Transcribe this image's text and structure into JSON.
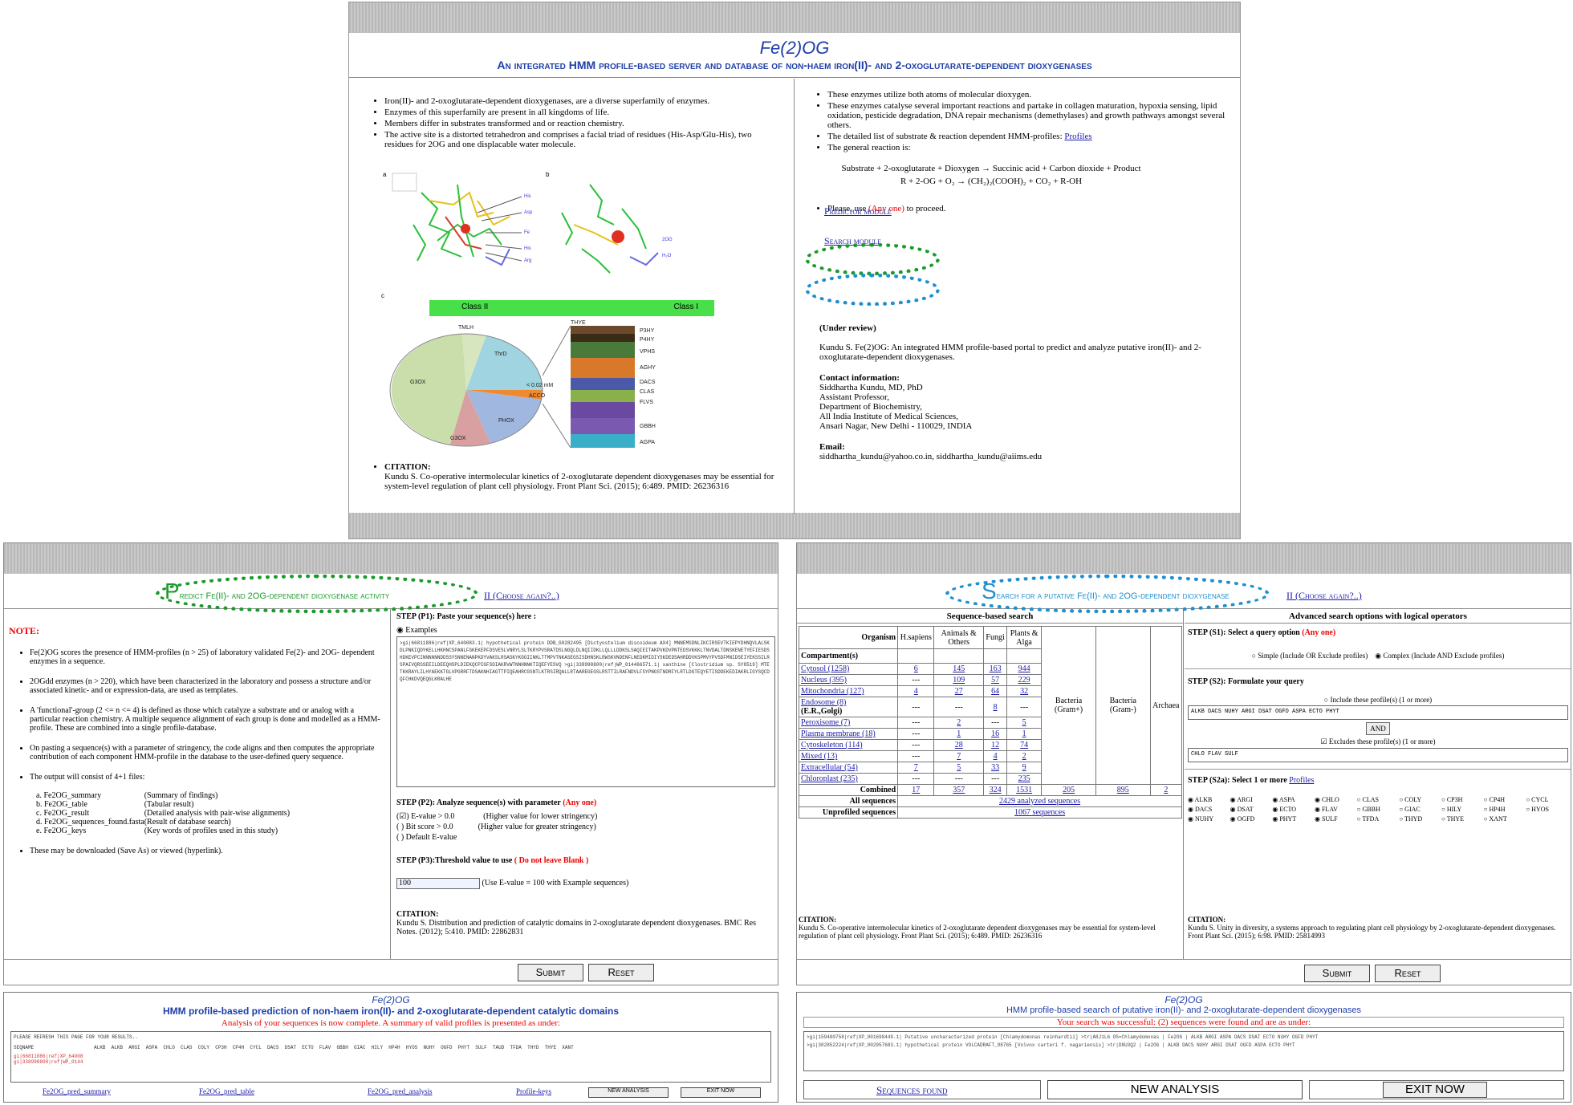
{
  "top": {
    "title": "Fe(2)OG",
    "subtitle": "An integrated HMM profile-based server and database of non-haem iron(II)- and 2-oxoglutarate-dependent dioxygenases",
    "left_bullets": [
      "Iron(II)- and 2-oxoglutarate-dependent dioxygenases, are a diverse superfamily of enzymes.",
      "Enzymes of this superfamily are present in all kingdoms of life.",
      "Members differ in substrates transformed and or reaction chemistry.",
      "The active site is a distorted tetrahedron and comprises a facial triad of residues (His-Asp/Glu-His), two residues for 2OG and one displacable water molecule."
    ],
    "fig_labels": {
      "a": "a",
      "b": "b",
      "c": "c"
    },
    "class_bar": {
      "left": "Class II",
      "right": "Class I"
    },
    "pie_labels": [
      "TMLH",
      "ThrD",
      "G3OX",
      "G3OX",
      "PHOX",
      "< 0.02 mM",
      "ACCO"
    ],
    "stack_labels": [
      "THYE",
      "P3HY",
      "P4HY",
      "VPHS",
      "AGHY",
      "DACS",
      "CLAS",
      "FLVS",
      "GBBH",
      "AGPA"
    ],
    "citation_label": "CITATION:",
    "citation_text": "Kundu S. Co-operative intermolecular kinetics of 2-oxoglutarate dependent dioxygenases may be essential for system-level regulation of plant cell physiology. Front Plant Sci. (2015); 6:489. PMID: 26236316",
    "right_bullets": [
      "These enzymes utilize both atoms of molecular dioxygen.",
      "These enzymes catalyse several important reactions and partake in collagen maturation, hypoxia sensing, lipid oxidation, pesticide degradation, DNA repair mechanisms (demethylases) and growth pathways amongst several others.",
      "The detailed list of substrate & reaction dependent HMM-profiles: ",
      "The general reaction is:"
    ],
    "profiles_link": "Profiles",
    "reaction1": "Substrate + 2-oxoglutarate + Dioxygen → Succinic acid + Carbon dioxide + Product",
    "reaction2": "R + 2-OG + O₂ → (CH₂)₂(COOH)₂ + CO₂ + R-OH",
    "please": "Please, use",
    "anyone": "(Any one)",
    "toproceed": "to proceed.",
    "predictor": "Predictor module",
    "search": "Search module",
    "under_review": "(Under review)",
    "review_text": "Kundu S. Fe(2)OG: An integrated HMM profile-based portal to predict and analyze putative iron(II)- and 2-oxoglutarate-dependent dioxygenases.",
    "contact_label": "Contact information:",
    "contact_lines": [
      "Siddhartha Kundu, MD, PhD",
      "Assistant Professor,",
      "Department of Biochemistry,",
      "All India Institute of Medical Sciences,",
      "Ansari Nagar, New Delhi - 110029, INDIA"
    ],
    "email_label": "Email:",
    "email_text": "siddhartha_kundu@yahoo.co.in,  siddhartha_kundu@aiims.edu"
  },
  "predict": {
    "header_big": "P",
    "header_rest": "redict Fe(II)- and 2OG-dependent dioxygenase activity",
    "choose": "II (Choose again?..)",
    "note": "NOTE:",
    "bullets": [
      "Fe(2)OG scores the presence of HMM-profiles (n > 25) of laboratory validated Fe(2)- and 2OG- dependent enzymes in a sequence.",
      "2OGdd enzymes (n > 220), which have been characterized in the laboratory and possess a structure and/or associated kinetic- and or expression-data, are used as templates.",
      "A 'functional'-group (2 <= n <= 4) is defined as those which catalyze a substrate and or analog with a particular reaction chemistry. A multiple sequence alignment of each group is done and modelled as a HMM-profile. These are combined into a single profile-database.",
      "On pasting a sequence(s) with a parameter of stringency, the code aligns and then computes the appropriate contribution of each component HMM-profile in the database to the user-defined query sequence.",
      "The output will consist of 4+1 files:"
    ],
    "files": [
      [
        "a. Fe2OG_summary",
        "(Summary of findings)"
      ],
      [
        "b. Fe2OG_table",
        "(Tabular result)"
      ],
      [
        "c. Fe2OG_result",
        "(Detailed analysis with pair-wise alignments)"
      ],
      [
        "d. Fe2OG_sequences_found.fasta",
        "(Result of database search)"
      ],
      [
        "e. Fe2OG_keys",
        "(Key words of profiles used in this study)"
      ]
    ],
    "download": "These may be downloaded (Save As) or viewed (hyperlink).",
    "p1": "STEP (P1): Paste your sequence(s) here :",
    "examples": "Examples",
    "seq_text": ">gi|66811886|ref|XP_640083.1| hypothetical protein DDB_G0282495 [Dictyostelium discoideum AX4] MNNEMSDNLIKCIRSEVTKIEPYDHNQVLALSKDLPNKIQDYKELLHKHNCSPANLFGKEKEPFDSVESLVNRYLSLTKRYPVSRATDSLNGQLDLNQIIDKLLQLLLDDKSLSAQIEITAKPVKDVPNTEDSVKKKLTNVDALTDNSKENETYEFIESDSHDKEVPCINNNNNNDDSSYSNNENANPKDYVAKSLRSASKYKGGIINKLTTMPVTNKASEGSISDHNSKLRWSKVNDENFLNEDKMIDIYSKDEDSAHRDDVKSPMVYPVSDFMNIDSEIYEKSSILRSPAIVQRSSEEILDEEQHSPLDIEKQCPIGFSDIAKRVWTNNHNNKTIQEFYESVQ >gi|338998800|ref|WP_014466571.1| xanthine [Clostridium sp. SY8519] MTETKKRAYLILHYAEKKTGLVPGRRFTDSAKNHIAGTTPIQEAHRCGSNTLKTRSIRQALLRTAAREGEGSLRSTTILRAFNDVLFSYPNGSTNDRFYLRTLDGTEQYETISDDEKEDIAKRLIGYSQCDQFCHKDVQEQGLKRALHE",
    "p2": "STEP (P2): Analyze sequence(s) with parameter",
    "p2_anyone": "(Any one)",
    "opts": [
      [
        "E-value > 0.0",
        "(Higher value for lower stringency)"
      ],
      [
        "Bit score > 0.0",
        "(Higher value for greater stringency)"
      ],
      [
        "Default E-value",
        ""
      ]
    ],
    "p3": "STEP (P3):Threshold value to use",
    "p3_warn": "( Do not leave Blank )",
    "threshold": "100",
    "threshold_hint": "(Use E-value = 100 with Example sequences)",
    "citation_label": "CITATION:",
    "citation_text": "Kundu S. Distribution and prediction of catalytic domains in 2-oxoglutarate dependent dioxygenases. BMC Res Notes. (2012); 5:410. PMID: 22862831",
    "submit": "Submit",
    "reset": "Reset"
  },
  "pred_result": {
    "title": "Fe(2)OG",
    "subtitle": "HMM profile-based prediction of non-haem iron(II)- and 2-oxoglutarate-dependent catalytic domains",
    "message": "Analysis of your sequences is now complete. A summary of valid profiles is presented as under:",
    "refresh": "PLEASE REFRESH THIS PAGE FOR YOUR RESULTS..",
    "seqname": "SEQNAME",
    "cols": "ALKB  ALKB  ARGI  ASPA  CHLO  CLAS  COLY  CP3H  CP4H  CYCL  DACS  DSAT  ECTO  FLAV  GBBH  GIAC  HILY  HP4H  HYOS  NUHY  OGFD  PHYT  SULF  TAUD  TFDA  THYD  THYE  XANT",
    "rows": [
      "gi|66811886|ref|XP_64008",
      "gi|338998800|ref|WP_0144"
    ],
    "links": [
      "Fe2OG_pred_summary",
      "Fe2OG_pred_table",
      "Fe2OG_pred_analysis",
      "Profile-keys"
    ],
    "new_analysis": "NEW ANALYSIS",
    "exit_now": "EXIT NOW"
  },
  "searchp": {
    "header_big": "S",
    "header_rest": "earch for a putative Fe(II)- and 2OG-dependent dioxygenase",
    "choose": "II (Choose again?..)",
    "seq_search": "Sequence-based search",
    "adv_search": "Advanced search options with logical operators",
    "organism_hdr": "Organism",
    "compartment_hdr": "Compartment(s)",
    "org_cols": [
      "H.sapiens",
      "Animals & Others",
      "Fungi",
      "Plants & Alga"
    ],
    "bact_cols": [
      "Bacteria (Gram+)",
      "Bacteria (Gram-)",
      "Archaea"
    ],
    "rows": [
      [
        "Cytosol (1258)",
        "6",
        "145",
        "163",
        "944"
      ],
      [
        "Nucleus (395)",
        "---",
        "109",
        "57",
        "229"
      ],
      [
        "Mitochondria (127)",
        "4",
        "27",
        "64",
        "32"
      ],
      [
        "Endosome (8)",
        "---",
        "---",
        "8",
        "---"
      ],
      [
        "Peroxisome (7)",
        "---",
        "2",
        "---",
        "5"
      ],
      [
        "Plasma membrane (18)",
        "---",
        "1",
        "16",
        "1"
      ],
      [
        "Cytoskeleton (114)",
        "---",
        "28",
        "12",
        "74"
      ],
      [
        "Mixed (13)",
        "---",
        "7",
        "4",
        "2"
      ],
      [
        "Extracellular (54)",
        "7",
        "5",
        "33",
        "9"
      ],
      [
        "Chloroplast (235)",
        "---",
        "---",
        "---",
        "235"
      ]
    ],
    "endo_sub": "(E.R.,Golgi)",
    "combined_label": "Combined",
    "combined": [
      "17",
      "357",
      "324",
      "1531",
      "205",
      "895",
      "2"
    ],
    "all_label": "All sequences",
    "all_val": "2429 analyzed sequences",
    "unprof_label": "Unprofiled sequences",
    "unprof_val": "1067 sequences",
    "s1": "STEP (S1): Select a query option",
    "s1_anyone": "(Any one)",
    "simple": "Simple (Include OR Exclude profiles)",
    "complex": "Complex (Include AND Exclude profiles)",
    "s2": "STEP (S2): Formulate your query",
    "include_lbl": "Include these profile(s) (1 or more)",
    "include_val": "ALKB DACS NUHY ARGI DSAT OGFD ASPA ECTO PHYT",
    "and_btn": "AND",
    "exclude_lbl": "Excludes these profile(s) (1 or more)",
    "exclude_val": "CHLO FLAV SULF",
    "s2a": "STEP (S2a): Select 1 or more",
    "profiles_link": "Profiles",
    "profile_grid": [
      "ALKB",
      "ARGI",
      "ASPA",
      "CHLO",
      "CLAS",
      "COLY",
      "CP3H",
      "CP4H",
      "CYCL",
      "DACS",
      "DSAT",
      "ECTO",
      "FLAV",
      "GBBH",
      "GIAC",
      "HILY",
      "HP4H",
      "HYOS",
      "NUHY",
      "OGFD",
      "PHYT",
      "SULF",
      "TFDA",
      "THYD",
      "THYE",
      "XANT"
    ],
    "cit_left_label": "CITATION:",
    "cit_left": "Kundu S. Co-operative intermolecular kinetics of 2-oxoglutarate dependent dioxygenases may be essential for system-level regulation of plant cell physiology. Front Plant Sci. (2015); 6:489. PMID: 26236316",
    "cit_right_label": "CITATION:",
    "cit_right": "Kundu S. Unity in diversity, a systems approach to regulating plant cell physiology by 2-oxoglutarate-dependent dioxygenases. Front Plant Sci. (2015); 6:98. PMID: 25814993",
    "submit": "Submit",
    "reset": "Reset"
  },
  "search_result": {
    "title": "Fe(2)OG",
    "subtitle": "HMM profile-based search of putative iron(II)- and 2-oxoglutarate-dependent dioxygenases",
    "message": "Your search was successful: (2) sequences were found and are as under:",
    "seq1": ">gi|159480758|ref|XP_001698449.1| Putative uncharacterized protein [Chlamydomonas reinhardtii] >tr|A8J1L6 OS=Chlamydomonas | Fe2OG | ALKB ARGI ASPA DACS DSAT ECTO NUHY OGFD PHYT",
    "seq2": ">gi|302852224|ref|XP_002957683.1| hypothetical protein VOLCADRAFT_98765 [Volvox carteri f. nagariensis] >tr|D8U3Q2 | Fe2OG | ALKB DACS NUHY ARGI DSAT OGFD ASPA ECTO PHYT",
    "seqfound": "Sequences found",
    "new_analysis": "NEW ANALYSIS",
    "exit_now": "EXIT NOW"
  },
  "colors": {
    "predictor_oval": "#1a9a2a",
    "search_oval": "#1e8fd0",
    "title_blue": "#1f3fa8",
    "link": "#1a1aa6",
    "red": "#e00000"
  }
}
